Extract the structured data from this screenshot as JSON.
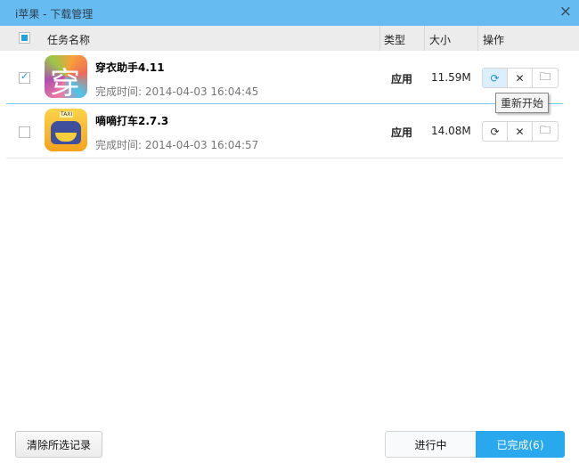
{
  "window": {
    "title": "i苹果 - 下载管理",
    "close_icon": "×"
  },
  "header": {
    "task_name": "任务名称",
    "type": "类型",
    "size": "大小",
    "actions": "操作"
  },
  "rows": [
    {
      "name": "穿衣助手4.11",
      "time": "完成时间: 2014-04-03 16:04:45",
      "type": "应用",
      "size": "11.59M",
      "checked": true,
      "icon_text": "穿"
    },
    {
      "name": "嘀嘀打车2.7.3",
      "time": "完成时间: 2014-04-03 16:04:57",
      "type": "应用",
      "size": "14.08M",
      "checked": false,
      "icon_text": "TAXI"
    }
  ],
  "action_icons": {
    "restart": "⟳",
    "delete": "✕",
    "folder": "🗀"
  },
  "tooltip": "重新开始",
  "footer": {
    "clear_selected": "清除所选记录",
    "in_progress": "进行中",
    "completed": "已完成(6)"
  },
  "colors": {
    "titlebar": "#66bcf0",
    "accent": "#29a8ee"
  }
}
